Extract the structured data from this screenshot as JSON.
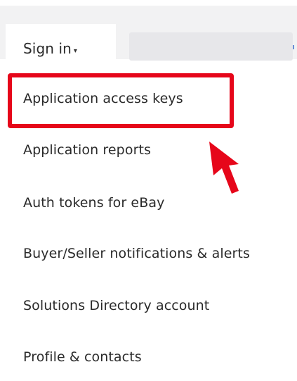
{
  "header": {
    "signin_label": "Sign in",
    "caret": "▾"
  },
  "menu": {
    "items": [
      {
        "label": "Application access keys",
        "highlighted": true
      },
      {
        "label": "Application reports"
      },
      {
        "label": "Auth tokens for eBay"
      },
      {
        "label": "Buyer/Seller notifications & alerts"
      },
      {
        "label": "Solutions Directory account"
      },
      {
        "label": "Profile & contacts"
      }
    ]
  },
  "annotation": {
    "highlight_color": "#e6061a",
    "arrow_color": "#e6061a"
  }
}
